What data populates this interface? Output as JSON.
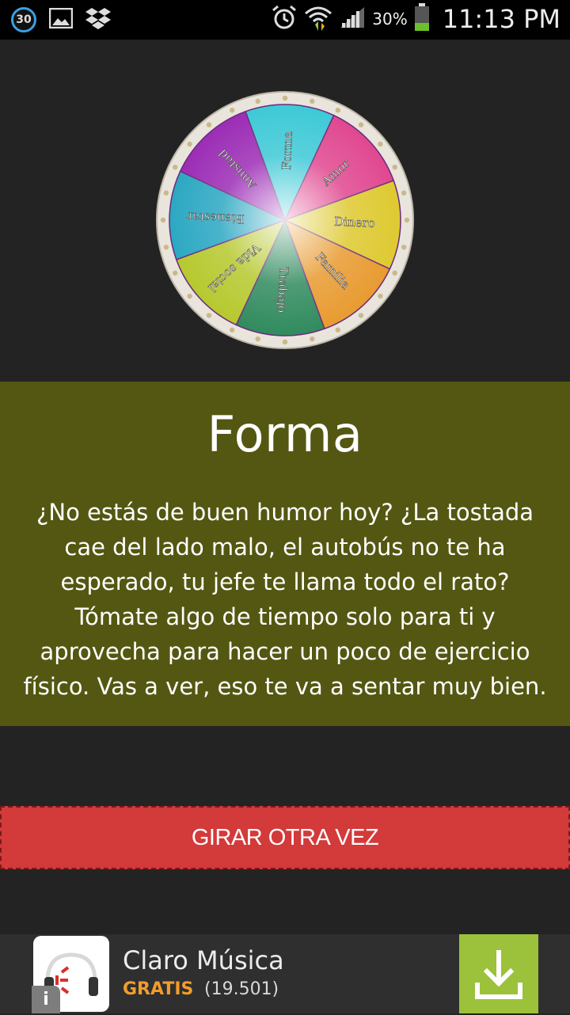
{
  "status_bar": {
    "notification_count": "30",
    "battery_percent": "30%",
    "time": "11:13 PM"
  },
  "wheel": {
    "segments": [
      {
        "label": "Forma",
        "color": "#3cc9d6"
      },
      {
        "label": "Amor",
        "color": "#e0468f"
      },
      {
        "label": "Dinero",
        "color": "#dec92f"
      },
      {
        "label": "Familia",
        "color": "#e89a2f"
      },
      {
        "label": "Trabajo",
        "color": "#2f8a5d"
      },
      {
        "label": "Vida social",
        "color": "#b6c82d"
      },
      {
        "label": "Bienestar",
        "color": "#2aa7c2"
      },
      {
        "label": "Amistad",
        "color": "#9b2bb5"
      }
    ]
  },
  "result": {
    "title": "Forma",
    "text": "¿No estás de buen humor hoy? ¿La tostada cae del lado malo, el autobús no te ha esperado, tu jefe te llama todo el rato? Tómate algo de tiempo solo para ti y aprovecha para hacer un poco de ejercicio físico. Vas a ver, eso te va a sentar muy bien."
  },
  "spin_button": {
    "label": "GIRAR OTRA VEZ"
  },
  "ad": {
    "app_name": "Claro Música",
    "price_label": "GRATIS",
    "rating_count": "(19.501)",
    "info_label": "i",
    "accent_color": "#9cc13a"
  }
}
